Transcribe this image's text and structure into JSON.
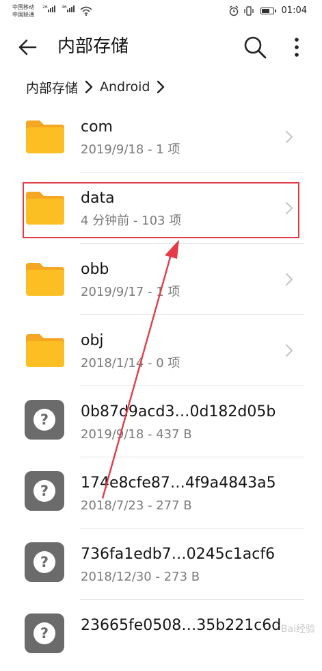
{
  "status_bar": {
    "carrier_1": "中国移动",
    "carrier_2": "中国联通",
    "network_1": "26",
    "network_2": "46",
    "time": "01:04"
  },
  "app_bar": {
    "title": "内部存储",
    "back_icon": "arrow-left",
    "search_icon": "magnifier",
    "more_icon": "vertical-dots"
  },
  "breadcrumb": {
    "items": [
      "内部存储",
      "Android"
    ]
  },
  "files": [
    {
      "name": "com",
      "meta": "2019/9/18 - 1 项",
      "type": "folder"
    },
    {
      "name": "data",
      "meta": "4 分钟前 - 103 项",
      "type": "folder"
    },
    {
      "name": "obb",
      "meta": "2019/9/17 - 1 项",
      "type": "folder"
    },
    {
      "name": "obj",
      "meta": "2018/1/14 - 0 项",
      "type": "folder"
    },
    {
      "name": "0b87d9acd3…0d182d05b",
      "meta": "2019/9/18 - 437 B",
      "type": "unknown"
    },
    {
      "name": "174e8cfe87…4f9a4843a5",
      "meta": "2018/7/23 - 277 B",
      "type": "unknown"
    },
    {
      "name": "736fa1edb7…0245c1acf6",
      "meta": "2018/12/30 - 273 B",
      "type": "unknown"
    },
    {
      "name": "23665fe0508…35b221c6d",
      "meta": "",
      "type": "unknown"
    }
  ],
  "annotation": {
    "color": "#e53a48",
    "highlighted_item": "data"
  },
  "colors": {
    "folder": "#fbbf24",
    "folder_tab": "#f5a623",
    "file_icon": "#6b6b6b",
    "meta_text": "#7a7a7a"
  },
  "watermark": {
    "text": "Bai经验"
  }
}
